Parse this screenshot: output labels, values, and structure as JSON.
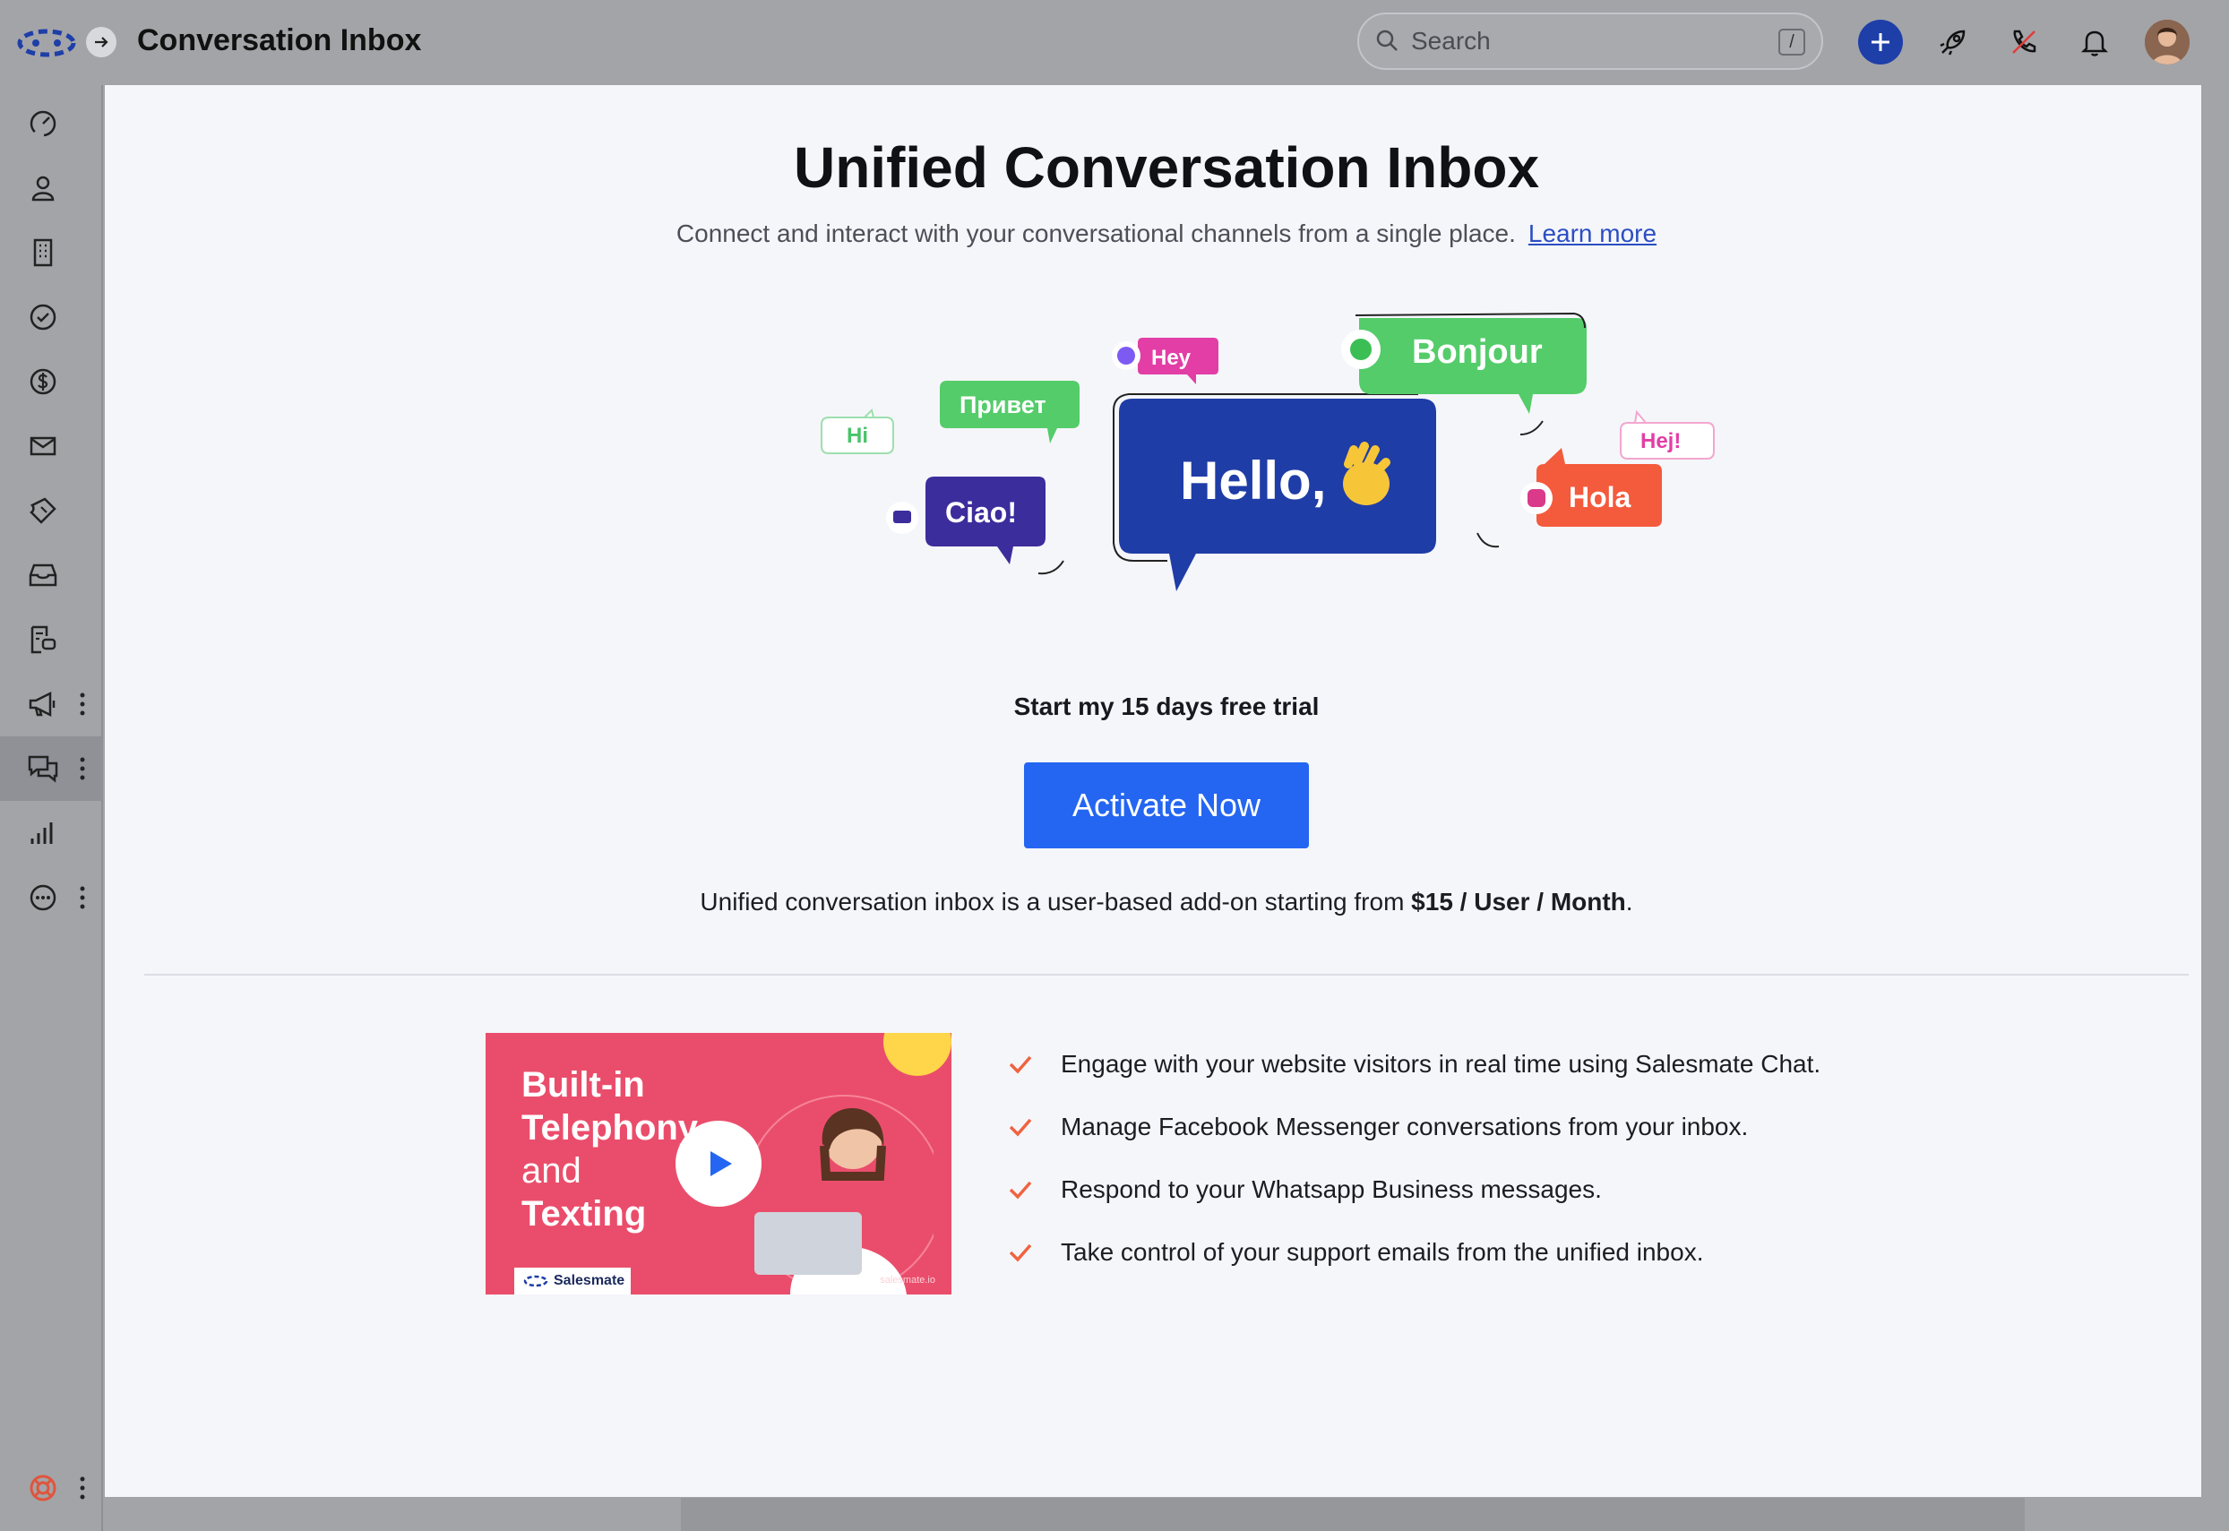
{
  "app": {
    "title": "Conversation Inbox"
  },
  "header": {
    "search_placeholder": "Search",
    "search_shortcut": "/"
  },
  "sidebar": {
    "items": [
      {
        "name": "dashboard",
        "icon": "speedometer-icon"
      },
      {
        "name": "contacts",
        "icon": "person-icon"
      },
      {
        "name": "companies",
        "icon": "building-icon"
      },
      {
        "name": "tasks",
        "icon": "check-circle-icon"
      },
      {
        "name": "deals",
        "icon": "dollar-icon"
      },
      {
        "name": "emails",
        "icon": "mail-icon"
      },
      {
        "name": "tickets",
        "icon": "ticket-icon"
      },
      {
        "name": "inbox",
        "icon": "inbox-tray-icon"
      },
      {
        "name": "sequences",
        "icon": "document-chat-icon"
      },
      {
        "name": "campaigns",
        "icon": "megaphone-icon"
      },
      {
        "name": "conversations",
        "icon": "chat-bubbles-icon",
        "active": true
      },
      {
        "name": "reports",
        "icon": "bar-chart-icon"
      },
      {
        "name": "more",
        "icon": "more-circle-icon"
      }
    ],
    "help_icon": "lifebuoy-icon"
  },
  "hero": {
    "title": "Unified Conversation Inbox",
    "subtitle": "Connect and interact with your conversational channels from a single place.",
    "learn_more": "Learn more"
  },
  "bubbles": {
    "hello": "Hello,",
    "bonjour": "Bonjour",
    "hey": "Hey",
    "privet": "Привет",
    "hi": "Hi",
    "ciao": "Ciao!",
    "hej": "Hej!",
    "hola": "Hola"
  },
  "trial": {
    "text": "Start my 15 days free trial",
    "button": "Activate Now",
    "pricing_prefix": "Unified conversation inbox is a user-based add-on starting from ",
    "pricing_value": "$15 / User / Month",
    "pricing_suffix": "."
  },
  "video": {
    "title_line1": "Built-in",
    "title_line2": "Telephony",
    "title_line3": "and",
    "title_line4": "Texting",
    "brand": "Salesmate",
    "url": "salesmate.io"
  },
  "features": [
    "Engage with your website visitors in real time using Salesmate Chat.",
    "Manage Facebook Messenger conversations from your inbox.",
    "Respond to your Whatsapp Business messages.",
    "Take control of your support emails from the unified inbox."
  ],
  "colors": {
    "accent": "#2466f1",
    "hello_bubble": "#1f3da6",
    "green_bubble": "#54cc6a",
    "pink_bubble": "#e23ea6",
    "purple_bubble": "#3b2d9c",
    "orange_bubble": "#f45a3c",
    "check": "#f0633f",
    "video_bg": "#ea4d6b"
  }
}
